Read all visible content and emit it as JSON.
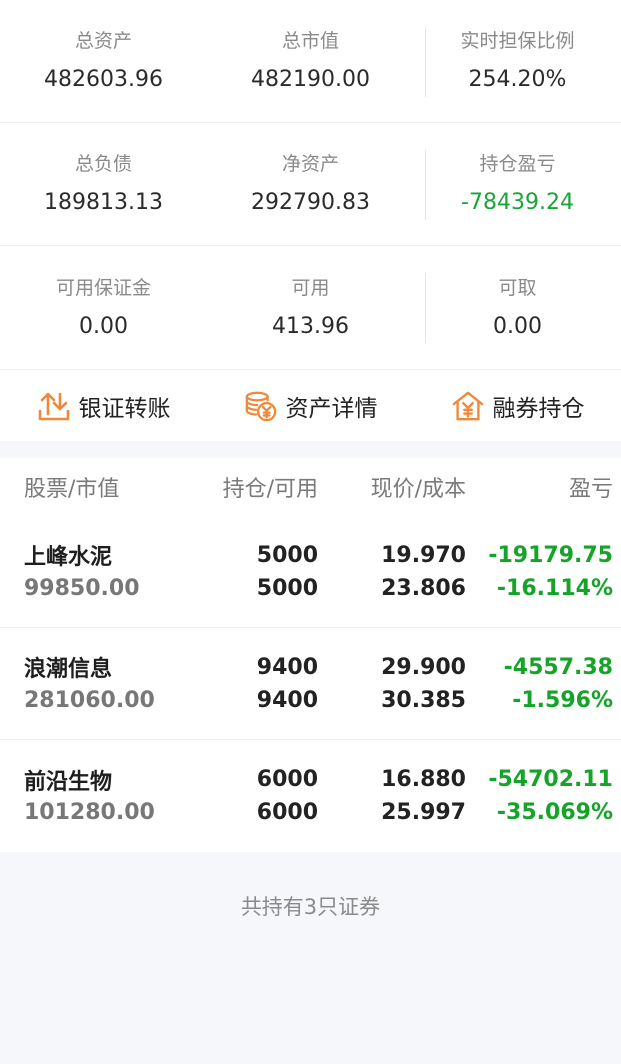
{
  "summary": {
    "rows": [
      [
        {
          "label": "总资产",
          "value": "482603.96"
        },
        {
          "label": "总市值",
          "value": "482190.00"
        },
        {
          "label": "实时担保比例",
          "value": "254.20%"
        }
      ],
      [
        {
          "label": "总负债",
          "value": "189813.13"
        },
        {
          "label": "净资产",
          "value": "292790.83"
        },
        {
          "label": "持仓盈亏",
          "value": "-78439.24"
        }
      ],
      [
        {
          "label": "可用保证金",
          "value": "0.00"
        },
        {
          "label": "可用",
          "value": "413.96"
        },
        {
          "label": "可取",
          "value": "0.00"
        }
      ]
    ]
  },
  "actions": [
    {
      "label": "银证转账",
      "icon": "transfer-arrows-icon"
    },
    {
      "label": "资产详情",
      "icon": "coins-yuan-icon"
    },
    {
      "label": "融券持仓",
      "icon": "house-yuan-icon"
    }
  ],
  "colors": {
    "orange": "#f0883a",
    "loss_green": "#15a32a"
  },
  "table": {
    "headers": [
      "股票/市值",
      "持仓/可用",
      "现价/成本",
      "盈亏"
    ],
    "rows": [
      {
        "name": "上峰水泥",
        "market_value": "99850.00",
        "position": "5000",
        "available": "5000",
        "price": "19.970",
        "cost": "23.806",
        "pnl": "-19179.75",
        "pnl_pct": "-16.114%"
      },
      {
        "name": "浪潮信息",
        "market_value": "281060.00",
        "position": "9400",
        "available": "9400",
        "price": "29.900",
        "cost": "30.385",
        "pnl": "-4557.38",
        "pnl_pct": "-1.596%"
      },
      {
        "name": "前沿生物",
        "market_value": "101280.00",
        "position": "6000",
        "available": "6000",
        "price": "16.880",
        "cost": "25.997",
        "pnl": "-54702.11",
        "pnl_pct": "-35.069%"
      }
    ]
  },
  "footer": {
    "text": "共持有3只证券"
  }
}
